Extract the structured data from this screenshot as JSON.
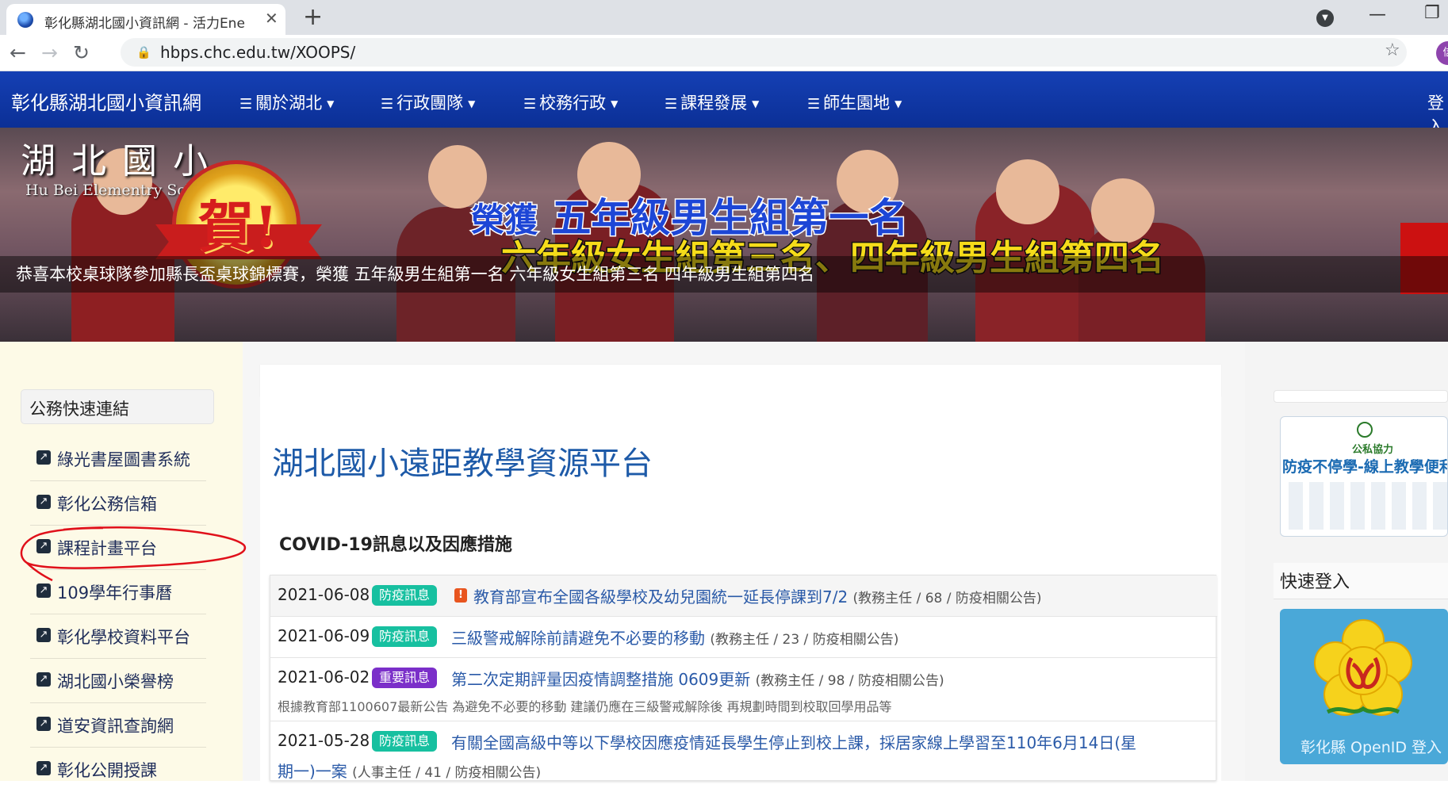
{
  "browser": {
    "tab_title": "彰化縣湖北國小資訊網 - 活力Ene",
    "tab_close": "✕",
    "new_tab": "+",
    "url": "hbps.chc.edu.tw/XOOPS/",
    "profile_initial": "信"
  },
  "nav": {
    "brand": "彰化縣湖北國小資訊網",
    "items": [
      {
        "label": "關於湖北"
      },
      {
        "label": "行政團隊"
      },
      {
        "label": "校務行政"
      },
      {
        "label": "課程發展"
      },
      {
        "label": "師生園地"
      }
    ],
    "login": "登入"
  },
  "banner": {
    "school_name": "湖北國小",
    "school_en": "Hu Bei Elementry School",
    "seal_text": "賀!",
    "headline_lead": "榮獲",
    "headline_main": "五年級男生組第一名",
    "headline_sub": "六年級女生組第三名、四年級男生組第四名",
    "caption": "恭喜本校桌球隊參加縣長盃桌球錦標賽，榮獲 五年級男生組第一名 六年級女生組第三名 四年級男生組第四名"
  },
  "sidebar": {
    "title": "公務快速連結",
    "links": [
      {
        "label": "綠光書屋圖書系統"
      },
      {
        "label": "彰化公務信箱"
      },
      {
        "label": "課程計畫平台"
      },
      {
        "label": "109學年行事曆"
      },
      {
        "label": "彰化學校資料平台"
      },
      {
        "label": "湖北國小榮譽榜"
      },
      {
        "label": "道安資訊查詢網"
      },
      {
        "label": "彰化公開授課"
      }
    ]
  },
  "main": {
    "page_title": "湖北國小遠距教學資源平台",
    "section_title": "COVID-19訊息以及因應措施",
    "news": [
      {
        "date": "2021-06-08",
        "badge": "防疫訊息",
        "alert": "!",
        "title": "教育部宣布全國各級學校及幼兒園統一延長停課到7/2",
        "meta": "(教務主任 / 68 / 防疫相關公告)"
      },
      {
        "date": "2021-06-09",
        "badge": "防疫訊息",
        "title": "三級警戒解除前請避免不必要的移動",
        "meta": "(教務主任 / 23 / 防疫相關公告)"
      },
      {
        "date": "2021-06-02",
        "badge": "重要訊息",
        "title": "第二次定期評量因疫情調整措施 0609更新",
        "meta": "(教務主任 / 98 / 防疫相關公告)",
        "summary": "根據教育部1100607最新公告 為避免不必要的移動 建議仍應在三級警戒解除後 再規劃時間到校取回學用品等"
      },
      {
        "date": "2021-05-28",
        "badge": "防疫訊息",
        "title": "有關全國高級中等以下學校因應疫情延長學生停止到校上課，採居家線上學習至110年6月14日(星",
        "title_line2": "期一)一案",
        "meta": "(人事主任 / 41 / 防疫相關公告)"
      }
    ]
  },
  "right": {
    "promo_sub": "公私協力",
    "promo_title": "防疫不停學-線上教學便利包",
    "fast_login": "快速登入",
    "openid_label": "彰化縣 OpenID 登入"
  },
  "colors": {
    "nav_blue": "#0b2f96",
    "badge_teal": "#17c0a0",
    "badge_purple": "#7b2fc9",
    "link_blue": "#2a5aa8",
    "annotation_red": "#e0101a"
  }
}
